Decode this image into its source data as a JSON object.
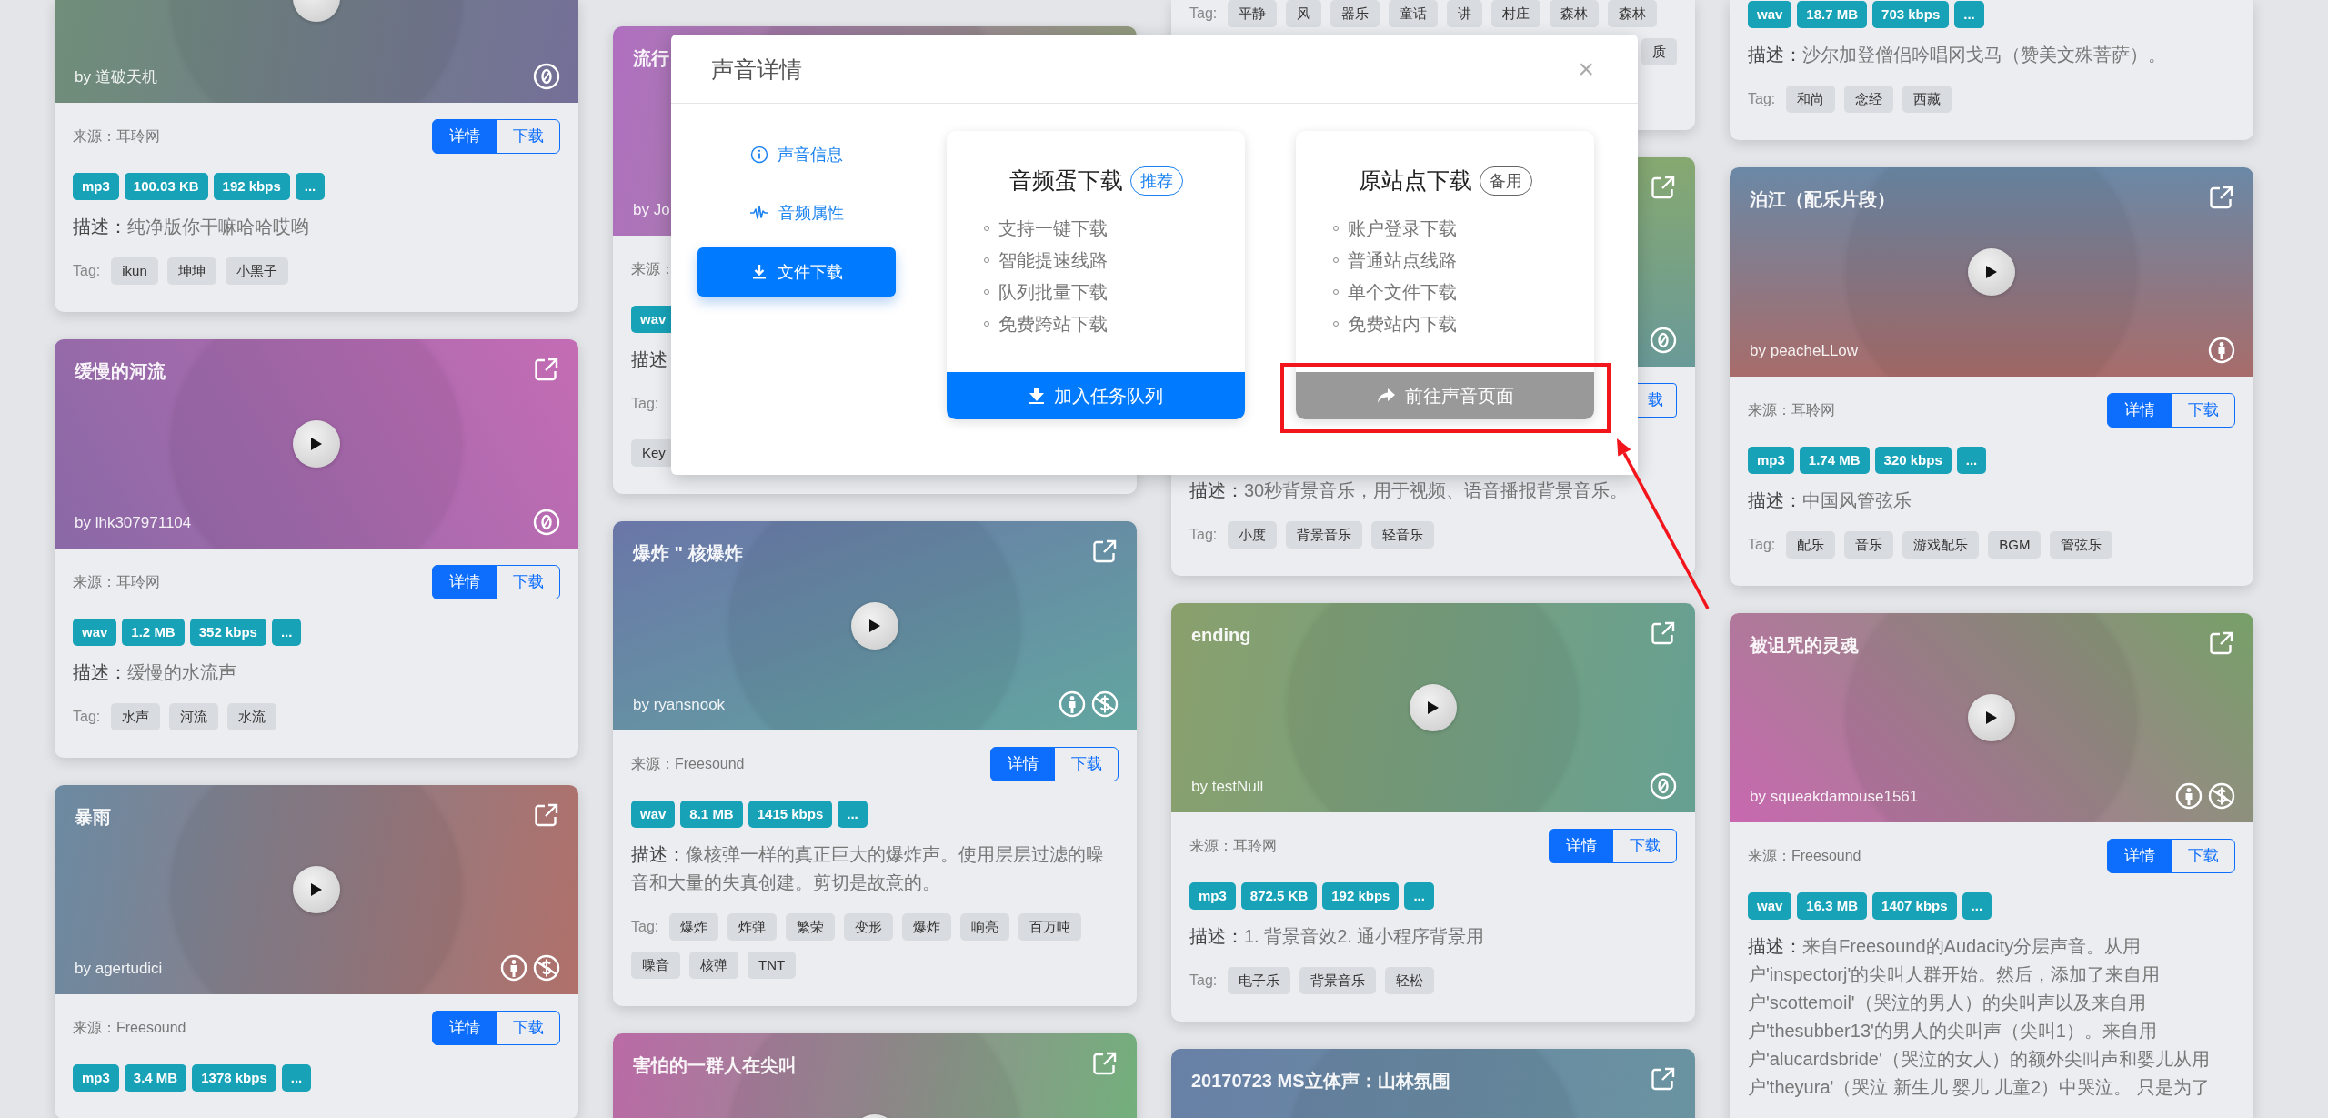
{
  "columns": [
    {
      "cards": [
        {
          "kind": "cut-cover",
          "cover": {
            "author": "by 道破天机",
            "licenses": [
              {
                "kind": "zero"
              }
            ]
          },
          "source": "来源：耳聆网",
          "actions": [
            {
              "label": "详情",
              "kind": "primary"
            },
            {
              "label": "下载",
              "kind": "outline"
            }
          ],
          "badges": [
            "mp3",
            "100.03 KB",
            "192 kbps",
            "..."
          ],
          "desc_label": "描述：",
          "desc": "纯净版你干嘛哈哈哎哟",
          "tags_label": "Tag:",
          "tags": [
            "ikun",
            "坤坤",
            "小黑子"
          ]
        },
        {
          "kind": "full",
          "cover": {
            "title": "缓慢的河流",
            "author": "by lhk307971104",
            "licenses": [
              {
                "kind": "zero"
              }
            ]
          },
          "source": "来源：耳聆网",
          "actions": [
            {
              "label": "详情",
              "kind": "primary"
            },
            {
              "label": "下载",
              "kind": "outline"
            }
          ],
          "badges": [
            "wav",
            "1.2 MB",
            "352 kbps",
            "..."
          ],
          "desc_label": "描述：",
          "desc": "缓慢的水流声",
          "tags_label": "Tag:",
          "tags": [
            "水声",
            "河流",
            "水流"
          ]
        },
        {
          "kind": "full",
          "cover": {
            "title": "暴雨",
            "author": "by agertudici",
            "licenses": [
              {
                "kind": "by"
              },
              {
                "kind": "nc"
              }
            ]
          },
          "source": "来源：Freesound",
          "actions": [
            {
              "label": "详情",
              "kind": "primary"
            },
            {
              "label": "下载",
              "kind": "outline"
            }
          ],
          "badges": [
            "mp3",
            "3.4 MB",
            "1378 kbps",
            "..."
          ]
        }
      ]
    },
    {
      "cards": [
        {
          "kind": "covered-right",
          "cover": {
            "title": "流行",
            "author": "by Jo"
          },
          "source": "来源：",
          "badges": [
            "wav"
          ],
          "desc_label": "描述",
          "tags_label": "Tag:",
          "tags": [
            "Key"
          ]
        },
        {
          "kind": "full",
          "cover": {
            "title": "爆炸 \" 核爆炸",
            "author": "by ryansnook",
            "licenses": [
              {
                "kind": "by"
              },
              {
                "kind": "nc"
              }
            ]
          },
          "source": "来源：Freesound",
          "actions": [
            {
              "label": "详情",
              "kind": "primary"
            },
            {
              "label": "下载",
              "kind": "outline"
            }
          ],
          "badges": [
            "wav",
            "8.1 MB",
            "1415 kbps",
            "..."
          ],
          "desc_label": "描述：",
          "desc": "像核弹一样的真正巨大的爆炸声。使用层层过滤的噪音和大量的失真创建。剪切是故意的。",
          "tags_label": "Tag:",
          "tags": [
            "爆炸",
            "炸弹",
            "繁荣",
            "变形",
            "爆炸",
            "响亮",
            "百万吨",
            "噪音",
            "核弹",
            "TNT"
          ]
        },
        {
          "kind": "full",
          "cover": {
            "title": "害怕的一群人在尖叫"
          }
        }
      ]
    },
    {
      "cards": [
        {
          "kind": "cut-tags",
          "tags_label": "Tag:",
          "tags": [
            "平静",
            "风",
            "器乐",
            "童话",
            "讲",
            "村庄",
            "森林",
            "森林",
            "质"
          ]
        },
        {
          "kind": "covered-left",
          "cover": {
            "licenses": [
              {
                "kind": "zero"
              }
            ]
          },
          "actions": [
            {
              "label": "载",
              "kind": "outline"
            }
          ],
          "desc_label": "描述：",
          "desc": "30秒背景音乐，用于视频、语音播报背景音乐。",
          "tags_label": "Tag:",
          "tags": [
            "小度",
            "背景音乐",
            "轻音乐"
          ]
        },
        {
          "kind": "full",
          "cover": {
            "title": "ending",
            "author": "by testNull",
            "licenses": [
              {
                "kind": "zero"
              }
            ]
          },
          "source": "来源：耳聆网",
          "actions": [
            {
              "label": "详情",
              "kind": "primary"
            },
            {
              "label": "下载",
              "kind": "outline"
            }
          ],
          "badges": [
            "mp3",
            "872.5 KB",
            "192 kbps",
            "..."
          ],
          "desc_label": "描述：",
          "desc": "1. 背景音效2. 通小程序背景用",
          "tags_label": "Tag:",
          "tags": [
            "电子乐",
            "背景音乐",
            "轻松"
          ]
        },
        {
          "kind": "full",
          "cover": {
            "title": "20170723 MS立体声：山林氛围"
          }
        }
      ]
    },
    {
      "cards": [
        {
          "kind": "cut-body",
          "badges": [
            "wav",
            "18.7 MB",
            "703 kbps",
            "..."
          ],
          "desc_label": "描述：",
          "desc": "沙尔加登僧侣吟唱冈戈马（赞美文殊菩萨）。",
          "tags_label": "Tag:",
          "tags": [
            "和尚",
            "念经",
            "西藏"
          ]
        },
        {
          "kind": "full",
          "cover": {
            "title": "泊江（配乐片段）",
            "author": "by peacheLLow",
            "licenses": [
              {
                "kind": "by"
              }
            ]
          },
          "source": "来源：耳聆网",
          "actions": [
            {
              "label": "详情",
              "kind": "primary"
            },
            {
              "label": "下载",
              "kind": "outline"
            }
          ],
          "badges": [
            "mp3",
            "1.74 MB",
            "320 kbps",
            "..."
          ],
          "desc_label": "描述：",
          "desc": "中国风管弦乐",
          "tags_label": "Tag:",
          "tags": [
            "配乐",
            "音乐",
            "游戏配乐",
            "BGM",
            "管弦乐"
          ]
        },
        {
          "kind": "full",
          "cover": {
            "title": "被诅咒的灵魂",
            "author": "by squeakdamouse1561",
            "licenses": [
              {
                "kind": "by"
              },
              {
                "kind": "nc"
              }
            ]
          },
          "source": "来源：Freesound",
          "actions": [
            {
              "label": "详情",
              "kind": "primary"
            },
            {
              "label": "下载",
              "kind": "outline"
            }
          ],
          "badges": [
            "wav",
            "16.3 MB",
            "1407 kbps",
            "..."
          ],
          "desc_label": "描述：",
          "desc": "来自Freesound的Audacity分层声音。从用户'inspectorj'的尖叫人群开始。然后，添加了来自用户'scottemoil'（哭泣的男人）的尖叫声以及来自用户'thesubber13'的男人的尖叫声（尖叫1）。来自用户'alucardsbride'（哭泣的女人）的额外尖叫声和婴儿从用户'theyura'（哭泣 新生儿 婴儿 儿童2）中哭泣。 只是为了"
        }
      ]
    }
  ],
  "modal": {
    "title": "声音详情",
    "close": "×",
    "nav": [
      {
        "label": "声音信息",
        "selected": false
      },
      {
        "label": "音频属性",
        "selected": false
      },
      {
        "label": "文件下载",
        "selected": true
      }
    ],
    "options": [
      {
        "kind": "primary",
        "title": "音频蛋下载",
        "badge": "推荐",
        "features": [
          "支持一键下载",
          "智能提速线路",
          "队列批量下载",
          "免费跨站下载"
        ],
        "action": "加入任务队列"
      },
      {
        "kind": "secondary",
        "title": "原站点下载",
        "badge": "备用",
        "features": [
          "账户登录下载",
          "普通站点线路",
          "单个文件下载",
          "免费站内下载"
        ],
        "action": "前往声音页面"
      }
    ]
  }
}
